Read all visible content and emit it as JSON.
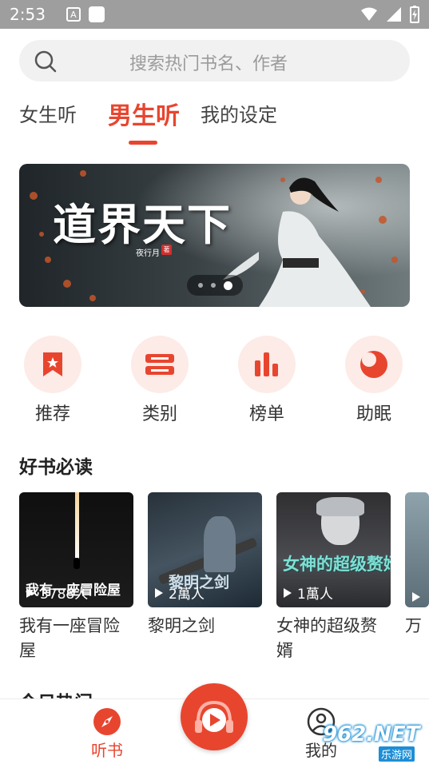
{
  "status_bar": {
    "time": "2:53",
    "notification_letter": "A"
  },
  "search": {
    "placeholder": "搜索热门书名、作者"
  },
  "tabs": [
    {
      "label": "女生听",
      "active": false
    },
    {
      "label": "男生听",
      "active": true
    },
    {
      "label": "我的设定",
      "active": false
    }
  ],
  "banner": {
    "title": "道界天下",
    "author": "夜行月",
    "author_seal": "著",
    "page_count": 3,
    "current_page": 3
  },
  "quick_links": [
    {
      "label": "推荐",
      "icon": "bookmark-star-icon"
    },
    {
      "label": "类别",
      "icon": "category-icon"
    },
    {
      "label": "榜单",
      "icon": "ranking-bars-icon"
    },
    {
      "label": "助眠",
      "icon": "moon-icon"
    }
  ],
  "section_good_books": {
    "title": "好书必读"
  },
  "books": [
    {
      "title": "我有一座冒险屋",
      "cover_text": "我有一座冒险屋",
      "listeners": "3788人"
    },
    {
      "title": "黎明之剑",
      "cover_text": "黎明之剑",
      "listeners": "2萬人"
    },
    {
      "title": "女神的超级赘婿",
      "cover_text": "女神的超级赘婿",
      "listeners": "1萬人"
    },
    {
      "title": "万",
      "cover_text": "",
      "listeners": ""
    }
  ],
  "section_today_hot": {
    "title": "今日热门"
  },
  "bottom_nav": {
    "left_label": "听书",
    "right_label": "我的"
  },
  "watermark": {
    "text": "962.NET",
    "sub": "乐游网"
  },
  "colors": {
    "accent": "#e8452f",
    "accent_light": "#fdebe7",
    "search_bg": "#f1f1f1",
    "status_bar": "#9e9e9e"
  }
}
